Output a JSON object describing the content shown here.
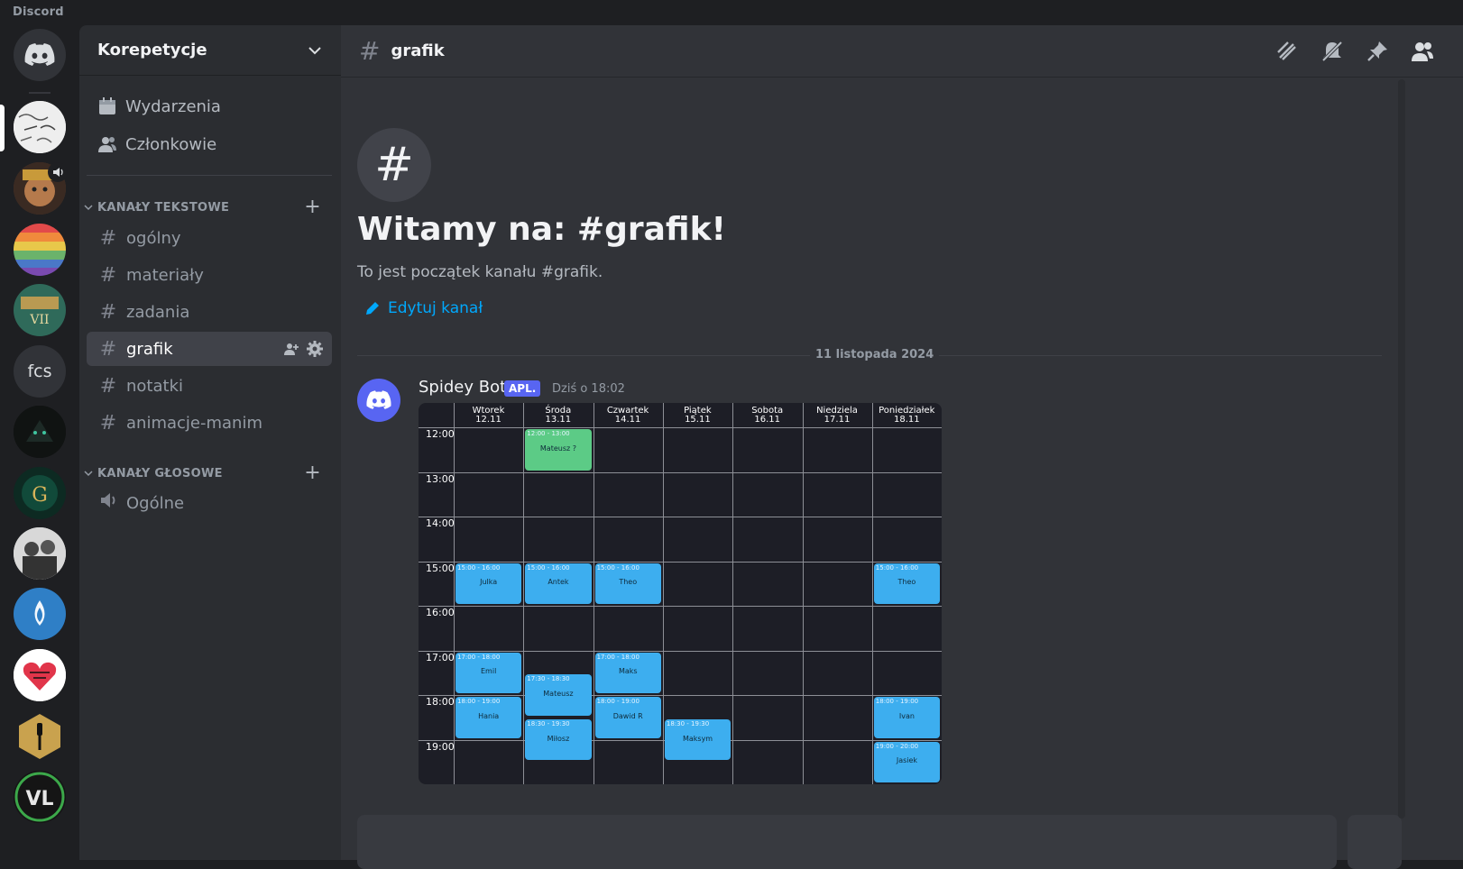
{
  "app": {
    "name": "Discord"
  },
  "rail": {
    "servers": [
      {
        "name": "home",
        "icon": "discord-logo-icon"
      },
      {
        "name": "math-server",
        "icon": "math-notes-avatar"
      },
      {
        "name": "character-server",
        "icon": "character-avatar"
      },
      {
        "name": "rainbow-server",
        "icon": "rainbow-avatar"
      },
      {
        "name": "heroes-server",
        "icon": "heroes-avatar"
      },
      {
        "name": "fcs",
        "label": "fcs"
      },
      {
        "name": "dark-server",
        "icon": "dark-creature-avatar"
      },
      {
        "name": "gwent-server",
        "icon": "gwent-avatar"
      },
      {
        "name": "soldiers-server",
        "icon": "soldiers-avatar"
      },
      {
        "name": "water-server",
        "icon": "water-drop-avatar"
      },
      {
        "name": "heart-server",
        "icon": "heart-avatar"
      },
      {
        "name": "cooking-server",
        "icon": "spatula-avatar"
      },
      {
        "name": "vl-server",
        "icon": "vl-logo-avatar"
      }
    ]
  },
  "sidebar": {
    "server_name": "Korepetycje",
    "nav": [
      {
        "label": "Wydarzenia",
        "icon": "calendar-icon"
      },
      {
        "label": "Członkowie",
        "icon": "members-icon"
      }
    ],
    "categories": {
      "text": "KANAŁY TEKSTOWE",
      "voice": "KANAŁY GŁOSOWE"
    },
    "text_channels": [
      "ogólny",
      "materiały",
      "zadania",
      "grafik",
      "notatki",
      "animacje-manim"
    ],
    "voice_channels": [
      "Ogólne"
    ]
  },
  "channel": {
    "name": "grafik",
    "welcome_title": "Witamy na: #grafik!",
    "welcome_sub": "To jest początek kanału #grafik.",
    "edit_label": "Edytuj kanał",
    "date_divider": "11 listopada 2024"
  },
  "message": {
    "author": "Spidey Bot",
    "tag": "APL.",
    "time": "Dziś o 18:02"
  },
  "schedule": {
    "days": [
      {
        "day": "Wtorek",
        "date": "12.11"
      },
      {
        "day": "Środa",
        "date": "13.11"
      },
      {
        "day": "Czwartek",
        "date": "14.11"
      },
      {
        "day": "Piątek",
        "date": "15.11"
      },
      {
        "day": "Sobota",
        "date": "16.11"
      },
      {
        "day": "Niedziela",
        "date": "17.11"
      },
      {
        "day": "Poniedziałek",
        "date": "18.11"
      }
    ],
    "hours": [
      "12:00",
      "13:00",
      "14:00",
      "15:00",
      "16:00",
      "17:00",
      "18:00",
      "19:00"
    ],
    "slots": [
      {
        "day": 1,
        "start": 12,
        "end": 13,
        "time": "12:00 - 13:00",
        "name": "Mateusz ?",
        "color": "#5ccb86"
      },
      {
        "day": 0,
        "start": 15,
        "end": 16,
        "time": "15:00 - 16:00",
        "name": "Julka",
        "color": "#3daeef"
      },
      {
        "day": 1,
        "start": 15,
        "end": 16,
        "time": "15:00 - 16:00",
        "name": "Antek",
        "color": "#3daeef"
      },
      {
        "day": 2,
        "start": 15,
        "end": 16,
        "time": "15:00 - 16:00",
        "name": "Theo",
        "color": "#3daeef"
      },
      {
        "day": 6,
        "start": 15,
        "end": 16,
        "time": "15:00 - 16:00",
        "name": "Theo",
        "color": "#3daeef"
      },
      {
        "day": 0,
        "start": 17,
        "end": 18,
        "time": "17:00 - 18:00",
        "name": "Emil",
        "color": "#3daeef"
      },
      {
        "day": 1,
        "start": 17.5,
        "end": 18.5,
        "time": "17:30 - 18:30",
        "name": "Mateusz",
        "color": "#3daeef"
      },
      {
        "day": 2,
        "start": 17,
        "end": 18,
        "time": "17:00 - 18:00",
        "name": "Maks",
        "color": "#3daeef"
      },
      {
        "day": 0,
        "start": 18,
        "end": 19,
        "time": "18:00 - 19:00",
        "name": "Hania",
        "color": "#3daeef"
      },
      {
        "day": 2,
        "start": 18,
        "end": 19,
        "time": "18:00 - 19:00",
        "name": "Dawid R",
        "color": "#3daeef"
      },
      {
        "day": 6,
        "start": 18,
        "end": 19,
        "time": "18:00 - 19:00",
        "name": "Ivan",
        "color": "#3daeef"
      },
      {
        "day": 1,
        "start": 18.5,
        "end": 19.5,
        "time": "18:30 - 19:30",
        "name": "Miłosz",
        "color": "#3daeef"
      },
      {
        "day": 3,
        "start": 18.5,
        "end": 19.5,
        "time": "18:30 - 19:30",
        "name": "Maksym",
        "color": "#3daeef"
      },
      {
        "day": 6,
        "start": 19,
        "end": 20,
        "time": "19:00 - 20:00",
        "name": "Jasiek",
        "color": "#3daeef"
      }
    ]
  }
}
